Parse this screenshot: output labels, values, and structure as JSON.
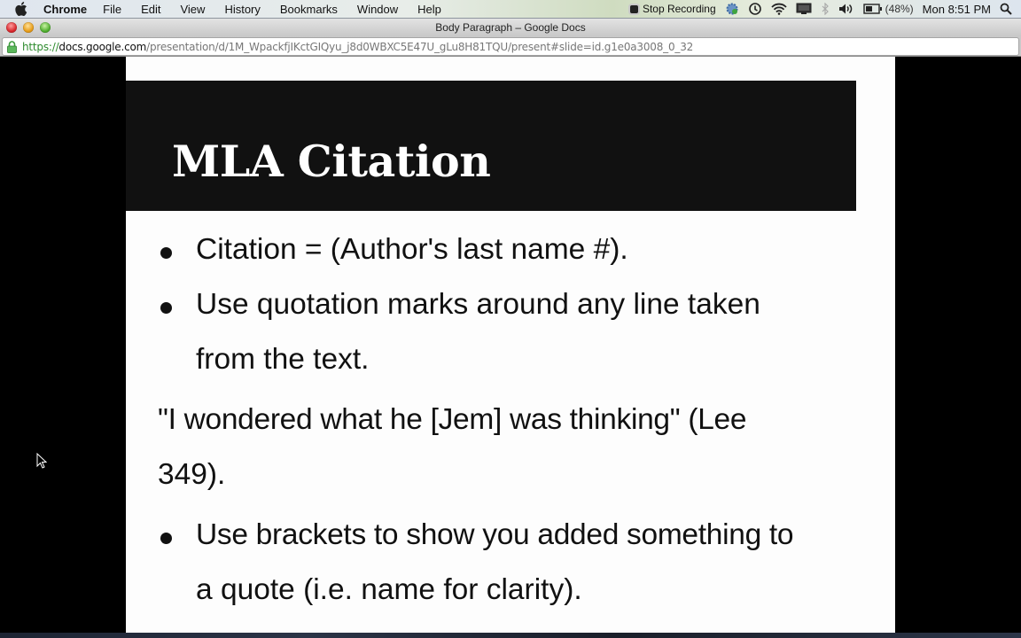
{
  "menubar": {
    "app_name": "Chrome",
    "items": [
      "File",
      "Edit",
      "View",
      "History",
      "Bookmarks",
      "Window",
      "Help"
    ],
    "status": {
      "recording_label": "Stop Recording",
      "battery": "(48%)",
      "clock": "Mon 8:51 PM",
      "icons": [
        "gear-sync-icon",
        "time-machine-icon",
        "wifi-icon",
        "display-icon",
        "bluetooth-icon",
        "volume-icon",
        "battery-icon",
        "spotlight-search-icon"
      ]
    }
  },
  "window": {
    "title": "Body Paragraph – Google Docs"
  },
  "address_bar": {
    "scheme": "https://",
    "host": "docs.google.com",
    "path": "/presentation/d/1M_WpackfjIKctGIQyu_j8d0WBXC5E47U_gLu8H81TQU/present#slide=id.g1e0a3008_0_32"
  },
  "slide": {
    "title": "MLA Citation",
    "colors": {
      "title_band": "#111111",
      "title_text": "#ffffff",
      "body_text": "#111111",
      "background": "#fdfdfd"
    },
    "lines": [
      {
        "bullet": true,
        "text": "Citation = (Author's last name #)."
      },
      {
        "bullet": true,
        "text": "Use quotation marks around any line taken"
      },
      {
        "bullet": false,
        "text": "from the text."
      },
      {
        "bullet": false,
        "text": "\"I wondered what he [Jem] was thinking\" (Lee"
      },
      {
        "bullet": false,
        "text": "349)."
      },
      {
        "bullet": true,
        "text": "Use brackets to show you added something to"
      },
      {
        "bullet": false,
        "text": "a quote (i.e. name for clarity)."
      }
    ]
  }
}
